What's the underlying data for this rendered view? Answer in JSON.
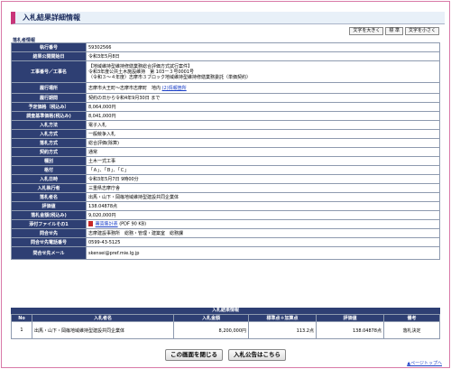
{
  "header": {
    "title": "入札結果詳細情報"
  },
  "font_buttons": {
    "larger": "文字を大きく",
    "standard": "標 準",
    "smaller": "文字を小さく"
  },
  "section": {
    "label": "落札者情報"
  },
  "details": [
    {
      "label": "執行番号",
      "value": "59302566"
    },
    {
      "label": "結果公開開始日",
      "value": "令和3年5月8日"
    },
    {
      "label": "工事番号／工事名",
      "lines": [
        "【地域維持型維持修繕業務総合評価方式試行案件】",
        "令和3年度公共土木施設維持　第 103ー３号0001号",
        "（令和３～４年度）志摩市３ブロック地域維持型維持修繕業務委託（単価契約）"
      ]
    },
    {
      "label": "履行場所",
      "value": "志摩市大王町～志摩市志摩町　地内",
      "link": "(2)情報箇所"
    },
    {
      "label": "履行期間",
      "value": "契約の日から令和4年9月30日 まで"
    },
    {
      "label": "予定価格（税込み）",
      "value": "8,064,000円"
    },
    {
      "label": "調査基準価格(税込み)",
      "value": "8,041,000円"
    },
    {
      "label": "入札方法",
      "value": "電子入札"
    },
    {
      "label": "入札方式",
      "value": "一般競争入札"
    },
    {
      "label": "落札方式",
      "value": "総合評価(除算)"
    },
    {
      "label": "契約方式",
      "value": "通常"
    },
    {
      "label": "種別",
      "value": "土木一式工事"
    },
    {
      "label": "格付",
      "value": "「Ａ」、「Ｂ」、「Ｃ」"
    },
    {
      "label": "入札日時",
      "value": "令和3年5月7日 9時00分"
    },
    {
      "label": "入札執行者",
      "value": "三重県志摩庁舎"
    },
    {
      "label": "落札者名",
      "value": "出馬・山下・岡篠地域維持型建設共同企業体"
    },
    {
      "label": "評価値",
      "value": "138.04878点"
    },
    {
      "label": "落札金額(税込み)",
      "value": "9,020,000円"
    },
    {
      "label": "添付ファイルその1",
      "link": "審査集計表",
      "suffix": "(PDF 90 KB)"
    },
    {
      "label": "問合せ先",
      "value": "志摩建設事務所　総務・管理・建築室　総務課"
    },
    {
      "label": "問合せ先電話番号",
      "value": "0599-43-5125"
    },
    {
      "label": "問合せ先メール",
      "value": "skensei@pref.mie.lg.jp"
    }
  ],
  "results": {
    "title": "入札結果情報",
    "columns": [
      "No",
      "入札者名",
      "入札金額",
      "標準点＋加算点",
      "評価値",
      "備考"
    ],
    "rows": [
      {
        "no": "1",
        "name": "出馬・山下・岡篠地域維持型建設共同企業体",
        "amount": "8,200,000円",
        "score": "113.2点",
        "evaluation": "138.04878点",
        "remarks": "落札決定"
      }
    ]
  },
  "buttons": {
    "close": "この画面を閉じる",
    "notice": "入札公告はこちら"
  },
  "footer": {
    "page_top": "▲ページトップへ"
  }
}
